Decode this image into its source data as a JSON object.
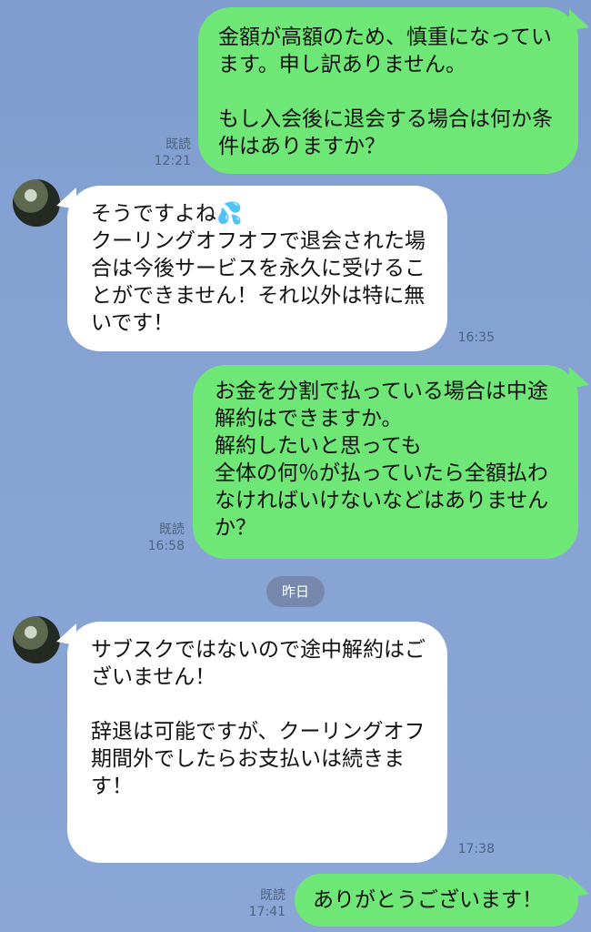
{
  "conversation": {
    "messages": [
      {
        "direction": "sent",
        "text": "金額が高額のため、慎重になっています。申し訳ありません。\n\nもし入会後に退会する場合は何か条件はありますか？",
        "status": "既読",
        "time": "12:21"
      },
      {
        "direction": "received",
        "text": "そうですよね💦\nクーリングオフオフで退会された場合は今後サービスを永久に受けることができません！それ以外は特に無いです！",
        "time": "16:35"
      },
      {
        "direction": "sent",
        "text": "お金を分割で払っている場合は中途解約はできますか。\n解約したいと思っても\n全体の何％が払っていたら全額払わなければいけないなどはありませんか？",
        "status": "既読",
        "time": "16:58"
      },
      {
        "direction": "received",
        "text": "サブスクではないので途中解約はございません！\n\n辞退は可能ですが、クーリングオフ期間外でしたらお支払いは続きます！",
        "time": "17:38"
      },
      {
        "direction": "sent",
        "text": "ありがとうございます！",
        "status": "既読",
        "time": "17:41"
      }
    ],
    "date_separator": "昨日"
  },
  "icons": {
    "avatar": "avatar-icon"
  },
  "colors": {
    "background": "#86a3d3",
    "sent_bubble": "#6fe776",
    "received_bubble": "#ffffff",
    "meta_text": "#4f627f",
    "date_chip": "#7689ad"
  }
}
